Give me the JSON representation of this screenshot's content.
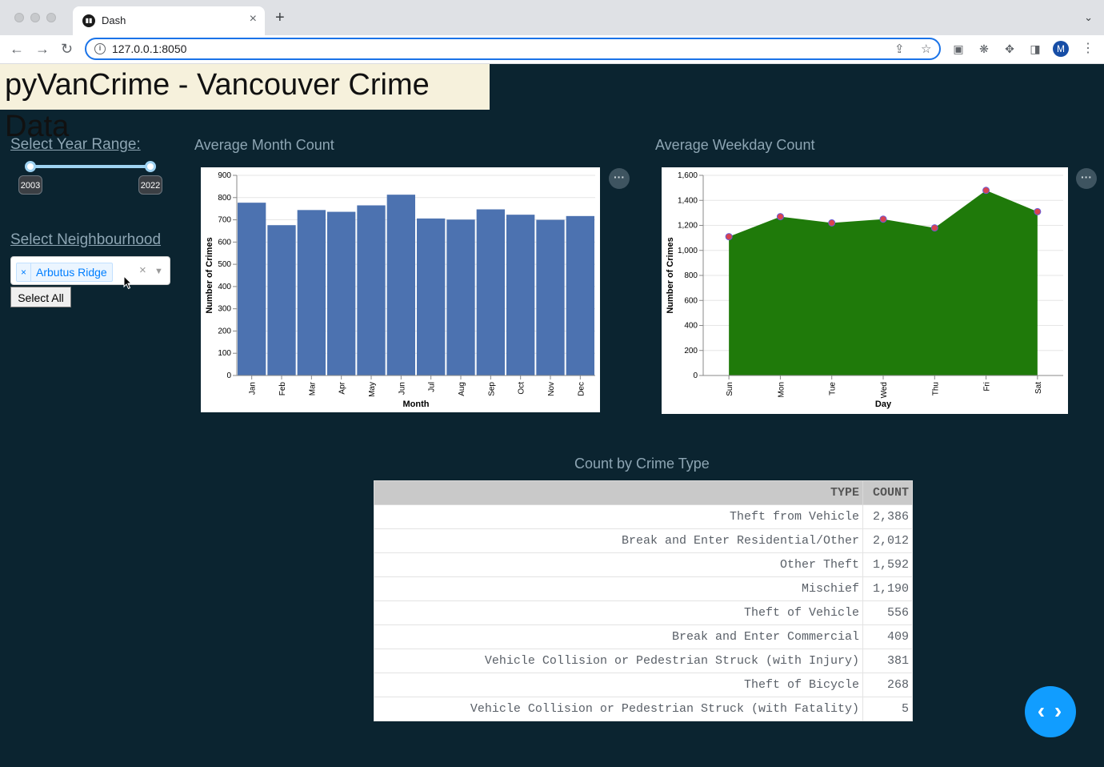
{
  "browser": {
    "tab_title": "Dash",
    "url": "127.0.0.1:8050",
    "profile_initial": "M"
  },
  "page": {
    "title": "pyVanCrime - Vancouver Crime Data"
  },
  "controls": {
    "year_range_label": "Select Year Range:",
    "year_min": "2003",
    "year_max": "2022",
    "neighbourhood_label": "Select Neighbourhood",
    "selected_neighbourhood": "Arbutus Ridge",
    "select_all_label": "Select All"
  },
  "colors": {
    "background": "#0b2430",
    "bar": "#4c72b0",
    "area": "#1f7a0a",
    "point": "#d9434f",
    "accent": "#119dff"
  },
  "chart_data": [
    {
      "type": "bar",
      "title": "Average Month Count",
      "xlabel": "Month",
      "ylabel": "Number of Crimes",
      "categories": [
        "Jan",
        "Feb",
        "Mar",
        "Apr",
        "May",
        "Jun",
        "Jul",
        "Aug",
        "Sep",
        "Oct",
        "Nov",
        "Dec"
      ],
      "values": [
        777,
        676,
        744,
        736,
        765,
        813,
        706,
        701,
        747,
        723,
        700,
        717
      ],
      "ylim": [
        0,
        900
      ],
      "yticks": [
        "0",
        "100",
        "200",
        "300",
        "400",
        "500",
        "600",
        "700",
        "800",
        "900"
      ],
      "grid": true
    },
    {
      "type": "area",
      "title": "Average Weekday Count",
      "xlabel": "Day",
      "ylabel": "Number of Crimes",
      "categories": [
        "Sun",
        "Mon",
        "Tue",
        "Wed",
        "Thu",
        "Fri",
        "Sat"
      ],
      "values": [
        1110,
        1270,
        1220,
        1250,
        1180,
        1480,
        1310
      ],
      "ylim": [
        0,
        1600
      ],
      "yticks": [
        "0",
        "200",
        "400",
        "600",
        "800",
        "1,000",
        "1,200",
        "1,400",
        "1,600"
      ],
      "grid": true
    }
  ],
  "table": {
    "title": "Count by Crime Type",
    "headers": [
      "TYPE",
      "COUNT"
    ],
    "rows": [
      [
        "Theft from Vehicle",
        "2,386"
      ],
      [
        "Break and Enter Residential/Other",
        "2,012"
      ],
      [
        "Other Theft",
        "1,592"
      ],
      [
        "Mischief",
        "1,190"
      ],
      [
        "Theft of Vehicle",
        "556"
      ],
      [
        "Break and Enter Commercial",
        "409"
      ],
      [
        "Vehicle Collision or Pedestrian Struck (with Injury)",
        "381"
      ],
      [
        "Theft of Bicycle",
        "268"
      ],
      [
        "Vehicle Collision or Pedestrian Struck (with Fatality)",
        "5"
      ]
    ]
  }
}
